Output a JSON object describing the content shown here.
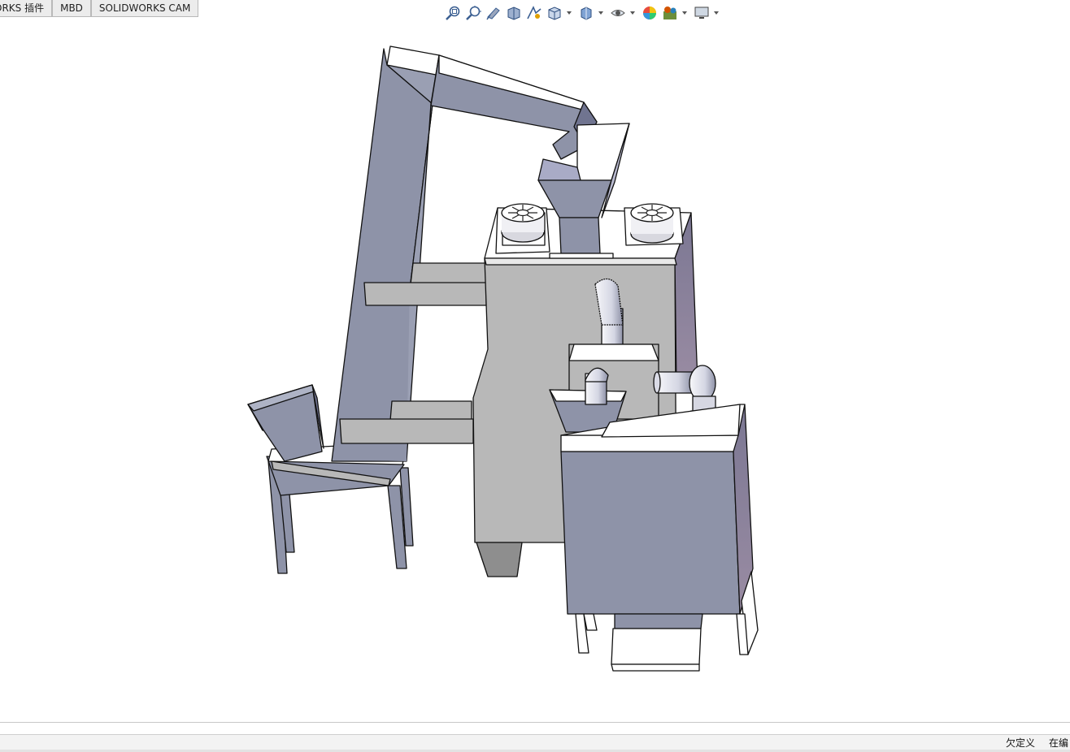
{
  "tabs": [
    {
      "label": "ORKS 插件"
    },
    {
      "label": "MBD"
    },
    {
      "label": "SOLIDWORKS CAM"
    }
  ],
  "heads_up_toolbar": [
    {
      "icon": "zoom-to-fit-icon"
    },
    {
      "icon": "zoom-to-area-icon"
    },
    {
      "icon": "previous-view-icon"
    },
    {
      "icon": "section-view-icon"
    },
    {
      "icon": "dynamic-annotation-icon"
    },
    {
      "icon": "view-orientation-icon",
      "dropdown": true
    },
    {
      "icon": "display-style-icon",
      "dropdown": true
    },
    {
      "icon": "hide-show-items-icon",
      "dropdown": true
    },
    {
      "icon": "edit-appearance-icon"
    },
    {
      "icon": "apply-scene-icon",
      "dropdown": true
    },
    {
      "icon": "view-settings-icon",
      "dropdown": true
    }
  ],
  "status_bar": {
    "definition_state": "欠定义",
    "editing_state": "在编"
  },
  "colors": {
    "part_blue": "#8e93a8",
    "part_grey": "#b8b8b8",
    "edge": "#111111"
  }
}
